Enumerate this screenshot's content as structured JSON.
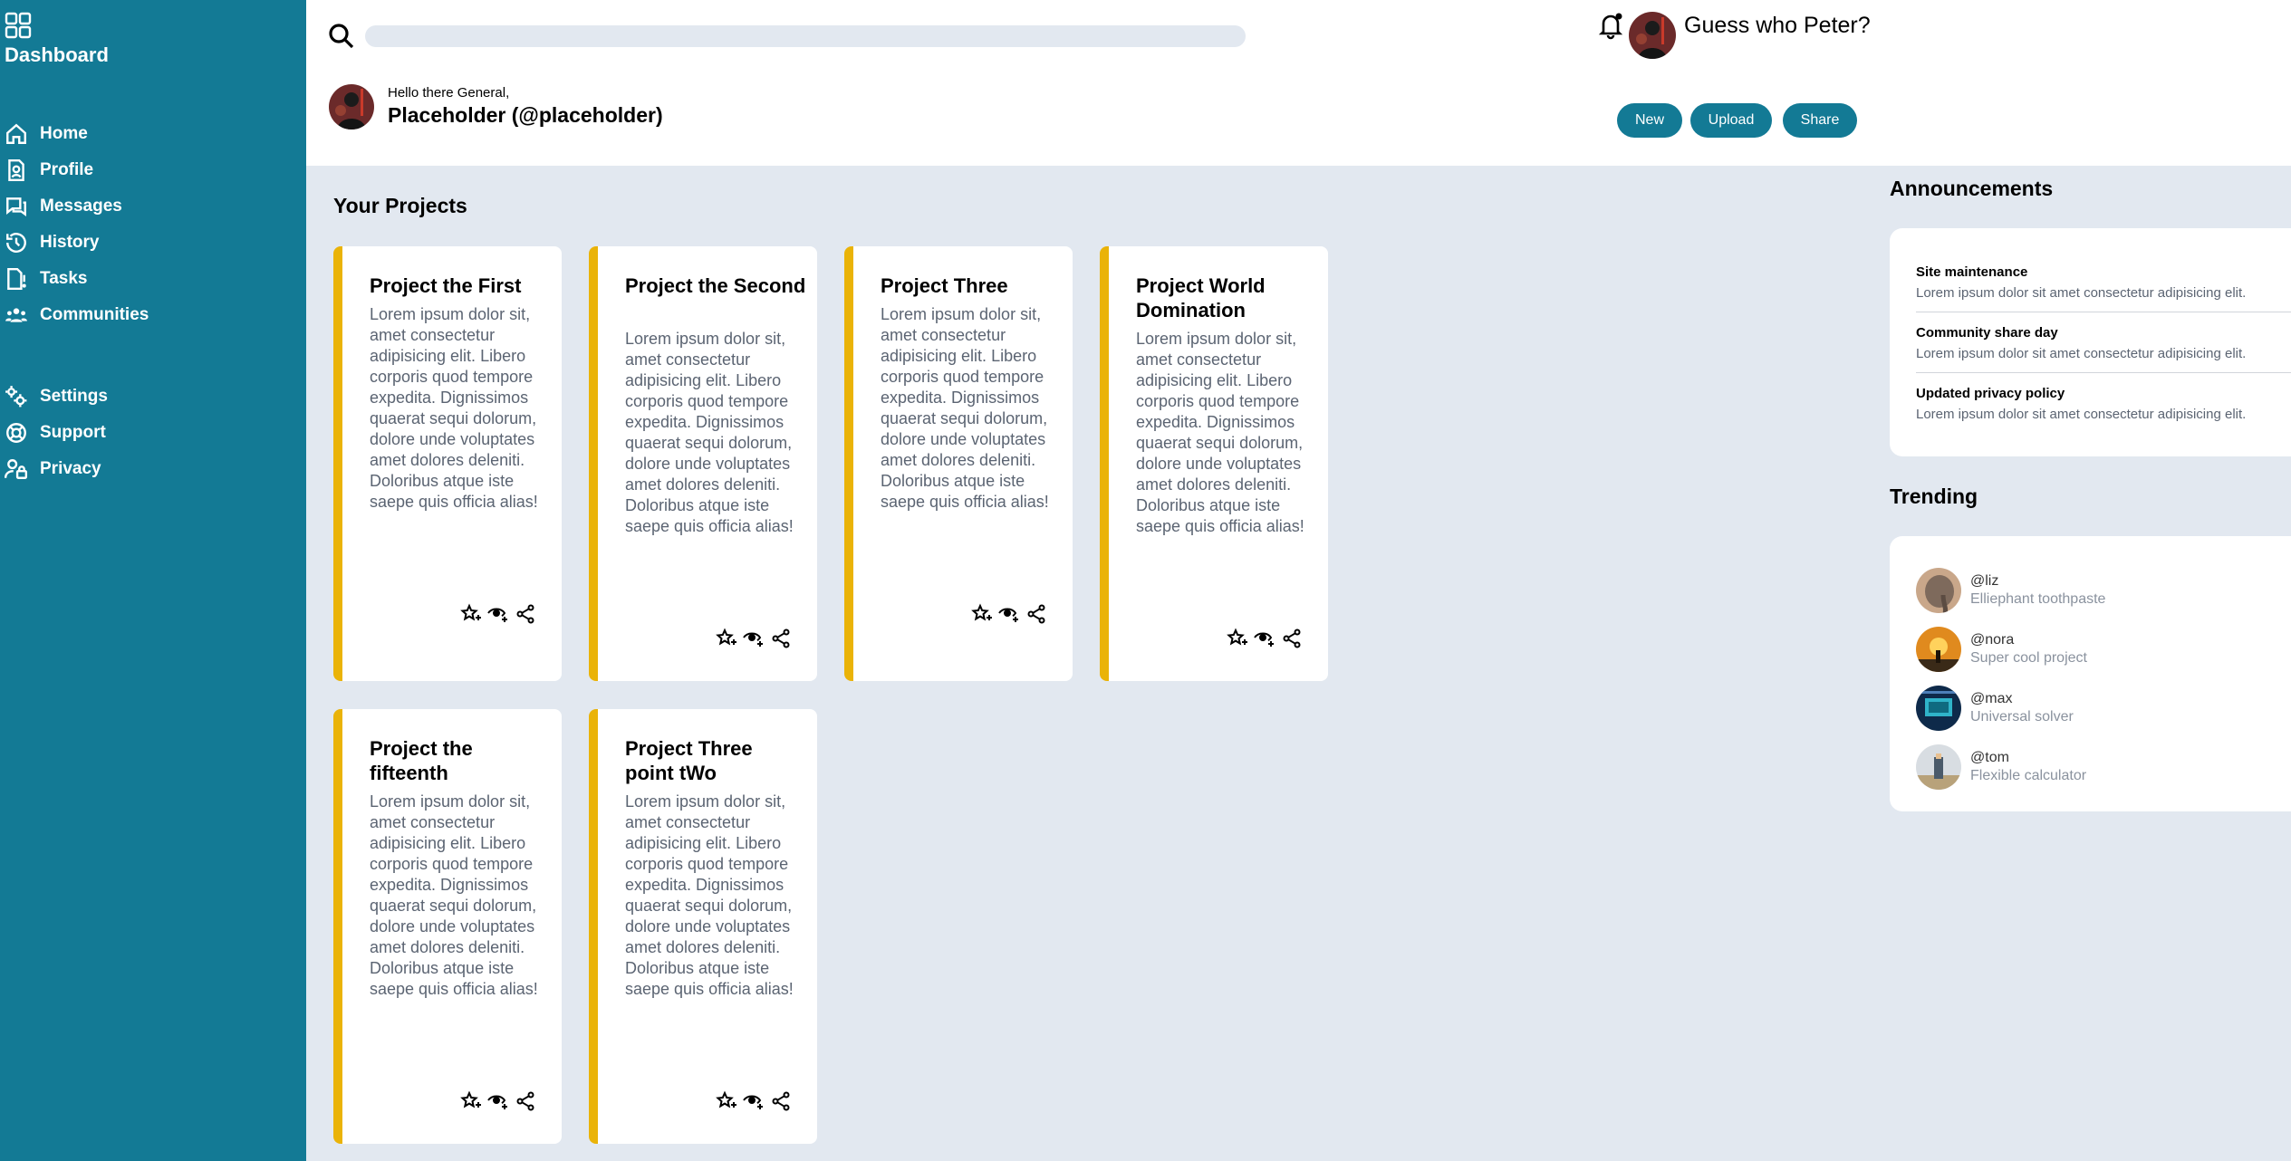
{
  "sidebar": {
    "title": "Dashboard",
    "items": [
      {
        "label": "Home",
        "icon": "home-icon"
      },
      {
        "label": "Profile",
        "icon": "profile-icon"
      },
      {
        "label": "Messages",
        "icon": "messages-icon"
      },
      {
        "label": "History",
        "icon": "history-icon"
      },
      {
        "label": "Tasks",
        "icon": "tasks-icon"
      },
      {
        "label": "Communities",
        "icon": "communities-icon"
      }
    ],
    "secondary_items": [
      {
        "label": "Settings",
        "icon": "settings-icon"
      },
      {
        "label": "Support",
        "icon": "support-icon"
      },
      {
        "label": "Privacy",
        "icon": "privacy-icon"
      }
    ]
  },
  "header": {
    "search": {
      "placeholder": "",
      "value": ""
    },
    "username": "Guess who Peter?",
    "greeting": "Hello there General,",
    "user_handle": "Placeholder (@placeholder)",
    "buttons": {
      "new": "New",
      "upload": "Upload",
      "share": "Share"
    }
  },
  "projects": {
    "heading": "Your Projects",
    "items": [
      {
        "title": "Project the First",
        "body": "Lorem ipsum dolor sit, amet consectetur adipisicing elit. Libero corporis quod tempore expedita. Dignissimos quaerat sequi dolorum, dolore unde voluptates amet dolores deleniti. Doloribus atque iste saepe quis officia alias!"
      },
      {
        "title": "Project the Second",
        "body": "Lorem ipsum dolor sit, amet consectetur adipisicing elit. Libero corporis quod tempore expedita. Dignissimos quaerat sequi dolorum, dolore unde voluptates amet dolores deleniti. Doloribus atque iste saepe quis officia alias!"
      },
      {
        "title": "Project Three",
        "body": "Lorem ipsum dolor sit, amet consectetur adipisicing elit. Libero corporis quod tempore expedita. Dignissimos quaerat sequi dolorum, dolore unde voluptates amet dolores deleniti. Doloribus atque iste saepe quis officia alias!"
      },
      {
        "title": "Project World Domination",
        "body": "Lorem ipsum dolor sit, amet consectetur adipisicing elit. Libero corporis quod tempore expedita. Dignissimos quaerat sequi dolorum, dolore unde voluptates amet dolores deleniti. Doloribus atque iste saepe quis officia alias!"
      },
      {
        "title": "Project the fifteenth",
        "body": "Lorem ipsum dolor sit, amet consectetur adipisicing elit. Libero corporis quod tempore expedita. Dignissimos quaerat sequi dolorum, dolore unde voluptates amet dolores deleniti. Doloribus atque iste saepe quis officia alias!"
      },
      {
        "title": "Project Three point tWo",
        "body": "Lorem ipsum dolor sit, amet consectetur adipisicing elit. Libero corporis quod tempore expedita. Dignissimos quaerat sequi dolorum, dolore unde voluptates amet dolores deleniti. Doloribus atque iste saepe quis officia alias!"
      }
    ],
    "action_icons": [
      "star-icon",
      "watch-icon",
      "share-icon"
    ]
  },
  "announcements": {
    "heading": "Announcements",
    "items": [
      {
        "title": "Site maintenance",
        "text": "Lorem ipsum dolor sit amet consectetur adipisicing elit."
      },
      {
        "title": "Community share day",
        "text": "Lorem ipsum dolor sit amet consectetur adipisicing elit."
      },
      {
        "title": "Updated privacy policy",
        "text": "Lorem ipsum dolor sit amet consectetur adipisicing elit."
      }
    ]
  },
  "trending": {
    "heading": "Trending",
    "items": [
      {
        "handle": "@liz",
        "desc": "Elliephant toothpaste"
      },
      {
        "handle": "@nora",
        "desc": "Super cool project"
      },
      {
        "handle": "@max",
        "desc": "Universal solver"
      },
      {
        "handle": "@tom",
        "desc": "Flexible calculator"
      }
    ]
  },
  "colors": {
    "sidebar": "#137a95",
    "accent": "#eab308",
    "background": "#e2e8f0"
  }
}
